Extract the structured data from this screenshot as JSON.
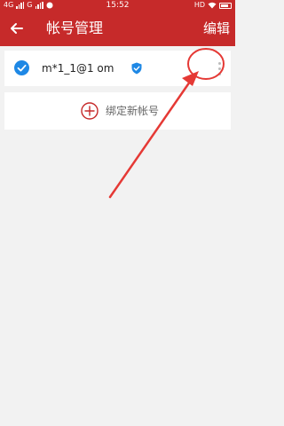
{
  "status_bar": {
    "network_label": "4G",
    "carrier_label": "G",
    "time": "15:52",
    "hd_label": "HD"
  },
  "toolbar": {
    "back_icon": "arrow-left-icon",
    "title": "帐号管理",
    "edit_label": "编辑"
  },
  "account": {
    "email": "m*1_1@1     om",
    "selected": true,
    "verified": true
  },
  "add_account": {
    "label": "绑定新帐号"
  },
  "colors": {
    "brand_red": "#c62a2a",
    "check_blue": "#1e88e5",
    "annotation_red": "#e53935",
    "background": "#f2f2f2"
  }
}
